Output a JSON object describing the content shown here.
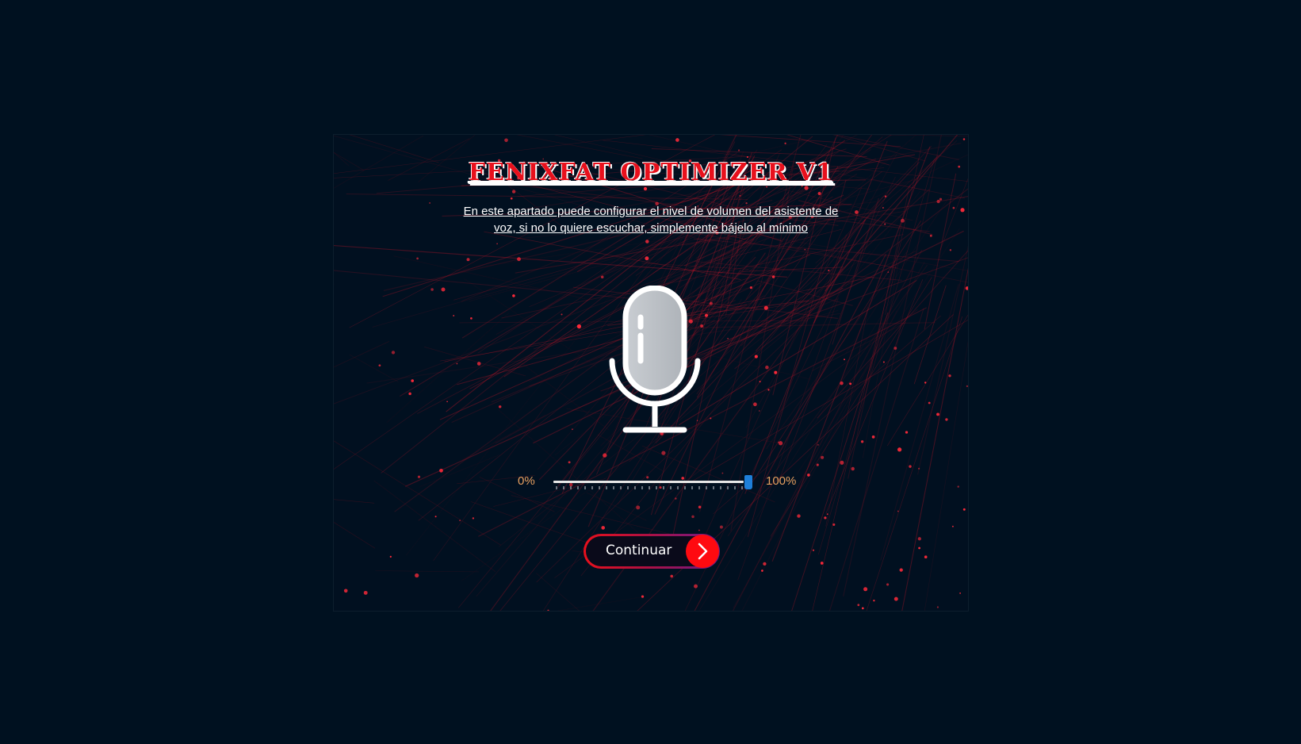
{
  "app": {
    "title": "FENIXFAT OPTIMIZER V1",
    "description": "En este apartado puede configurar el nivel de volumen del asistente de voz, si no lo quiere escuchar, simplemente bájelo al mínimo"
  },
  "volume": {
    "min_label": "0%",
    "max_label": "100%",
    "value": 100
  },
  "continue_button": {
    "label": "Continuar",
    "icon": "chevron-right-icon"
  },
  "icons": {
    "microphone": "microphone-icon"
  },
  "colors": {
    "background": "#001120",
    "accent_red": "#e8101c",
    "slider_thumb": "#1e7fd8",
    "percent_text": "#e8a060"
  }
}
